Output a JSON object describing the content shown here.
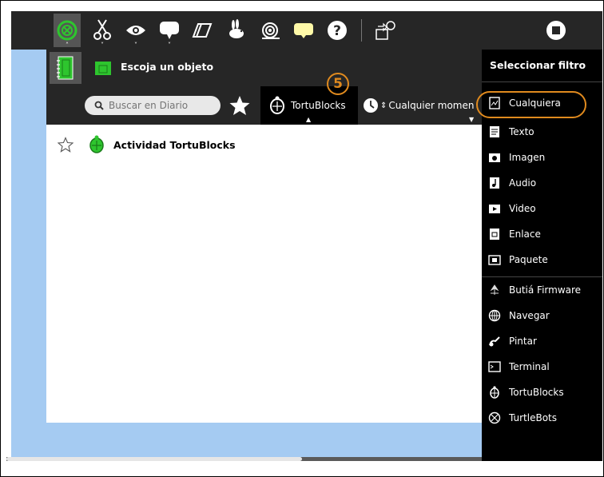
{
  "toolbar": {
    "icons": [
      "activity-journal-icon",
      "cut-icon",
      "view-icon",
      "speech-icon",
      "eraser-icon",
      "rabbit-fast-icon",
      "snail-slow-icon",
      "help-bubble-icon",
      "help-icon",
      "export-icon",
      "stop-icon"
    ]
  },
  "dialog": {
    "title": "Escoja un objeto",
    "search_placeholder": "Buscar en Diario",
    "filter_activity_label": "TortuBlocks",
    "filter_time_label": "Cualquier momen"
  },
  "entries": [
    {
      "label": "Actividad TortuBlocks"
    }
  ],
  "sidebar": {
    "title": "Seleccionar filtro",
    "types": [
      {
        "label": "Cualquiera"
      },
      {
        "label": "Texto"
      },
      {
        "label": "Imagen"
      },
      {
        "label": "Audio"
      },
      {
        "label": "Video"
      },
      {
        "label": "Enlace"
      },
      {
        "label": "Paquete"
      }
    ],
    "activities": [
      {
        "label": "Butiá Firmware"
      },
      {
        "label": "Navegar"
      },
      {
        "label": "Pintar"
      },
      {
        "label": "Terminal"
      },
      {
        "label": "TortuBlocks"
      },
      {
        "label": "TurtleBots"
      }
    ]
  },
  "callout": {
    "number": "5"
  },
  "colors": {
    "toolbar": "#262626",
    "backdrop": "#a5cbf2",
    "accent_green": "#2ec52e",
    "callout": "#e08a1e"
  }
}
